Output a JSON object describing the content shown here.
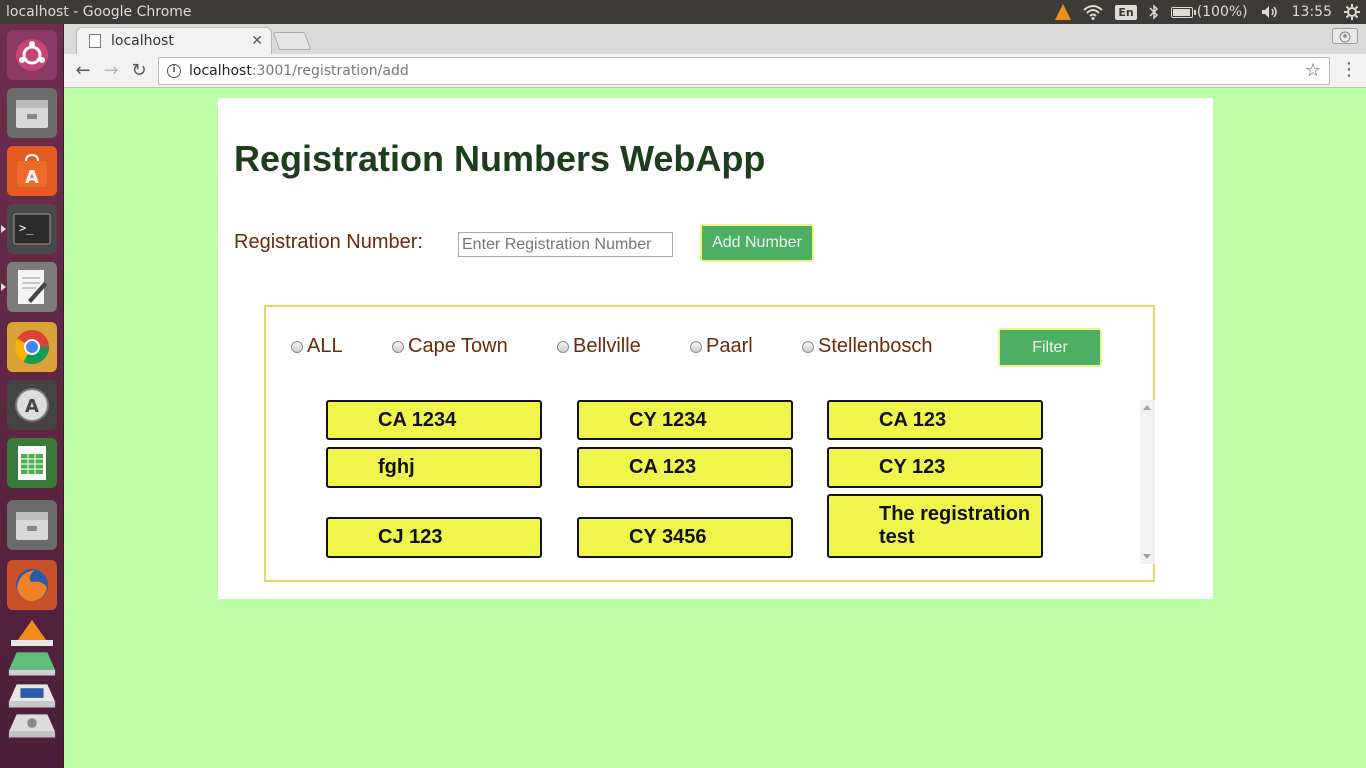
{
  "os": {
    "window_title": "localhost - Google Chrome",
    "keyboard_layout": "En",
    "battery_label": "(100%)",
    "battery_level": 1.0,
    "clock": "13:55"
  },
  "browser": {
    "tab_title": "localhost",
    "url_host": "localhost",
    "url_path": ":3001/registration/add"
  },
  "page": {
    "title": "Registration Numbers WebApp",
    "reg_label": "Registration Number:",
    "reg_placeholder": "Enter Registration Number",
    "add_button": "Add Number",
    "filter_button": "Filter",
    "radios": [
      {
        "label": "ALL",
        "selected": false
      },
      {
        "label": "Cape Town",
        "selected": false
      },
      {
        "label": "Bellville",
        "selected": false
      },
      {
        "label": "Paarl",
        "selected": false
      },
      {
        "label": "Stellenbosch",
        "selected": false
      }
    ],
    "plates": [
      "CA 1234",
      "CY 1234",
      "CA 123",
      "fghj",
      "CA 123",
      "CY 123",
      "CJ 123",
      "CY 3456",
      "The registration test"
    ]
  },
  "colors": {
    "page_bg": "#bdfda7",
    "button_green": "#4caf63",
    "plate_yellow": "#f0f54b",
    "label_brown": "#6b2a0a",
    "title_green": "#1d3d1d",
    "filter_border": "#f2cf6e"
  }
}
